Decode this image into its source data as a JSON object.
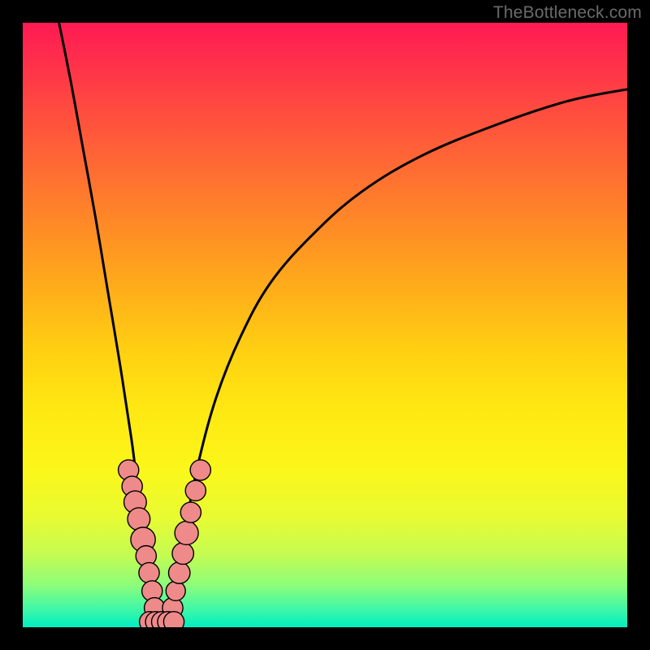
{
  "watermark": "TheBottleneck.com",
  "chart_data": {
    "type": "line",
    "title": "",
    "xlabel": "",
    "ylabel": "",
    "xlim": [
      0,
      100
    ],
    "ylim": [
      0,
      100
    ],
    "series": [
      {
        "name": "left-curve",
        "x": [
          6,
          8,
          10,
          12,
          14,
          16,
          18,
          19,
          20,
          21,
          21.7,
          22.2
        ],
        "y": [
          100,
          90,
          79,
          68,
          56,
          44,
          31,
          23,
          16,
          9,
          3,
          0
        ]
      },
      {
        "name": "right-curve",
        "x": [
          24.2,
          25,
          26,
          27,
          29,
          32,
          36,
          41,
          48,
          56,
          66,
          78,
          90,
          100
        ],
        "y": [
          0,
          4,
          11,
          17,
          27,
          38,
          48,
          57,
          65,
          72,
          78,
          83,
          87,
          89
        ]
      }
    ],
    "markers": {
      "left_cluster": [
        {
          "x": 17.5,
          "y": 26.0,
          "r": 1.2
        },
        {
          "x": 18.1,
          "y": 23.3,
          "r": 1.2
        },
        {
          "x": 18.6,
          "y": 20.7,
          "r": 1.4
        },
        {
          "x": 19.2,
          "y": 17.9,
          "r": 1.4
        },
        {
          "x": 19.9,
          "y": 14.5,
          "r": 1.6
        },
        {
          "x": 20.4,
          "y": 11.8,
          "r": 1.2
        },
        {
          "x": 20.9,
          "y": 9.0,
          "r": 1.2
        },
        {
          "x": 21.4,
          "y": 6.0,
          "r": 1.2
        },
        {
          "x": 21.8,
          "y": 3.2,
          "r": 1.2
        }
      ],
      "right_cluster": [
        {
          "x": 24.8,
          "y": 3.2,
          "r": 1.2
        },
        {
          "x": 25.3,
          "y": 6.0,
          "r": 1.1
        },
        {
          "x": 25.9,
          "y": 9.0,
          "r": 1.3
        },
        {
          "x": 26.5,
          "y": 12.2,
          "r": 1.3
        },
        {
          "x": 27.1,
          "y": 15.6,
          "r": 1.5
        },
        {
          "x": 27.8,
          "y": 19.0,
          "r": 1.2
        },
        {
          "x": 28.6,
          "y": 22.6,
          "r": 1.2
        },
        {
          "x": 29.4,
          "y": 26.0,
          "r": 1.2
        }
      ],
      "bottom_cluster": [
        {
          "x": 21.0,
          "y": 0.9,
          "r": 1.2
        },
        {
          "x": 22.0,
          "y": 0.9,
          "r": 1.2
        },
        {
          "x": 23.0,
          "y": 0.9,
          "r": 1.2
        },
        {
          "x": 24.0,
          "y": 0.9,
          "r": 1.2
        },
        {
          "x": 25.0,
          "y": 0.9,
          "r": 1.2
        }
      ]
    },
    "colors": {
      "curve": "#000000",
      "marker_fill": "#ef8a8a",
      "marker_stroke": "#000000"
    }
  }
}
